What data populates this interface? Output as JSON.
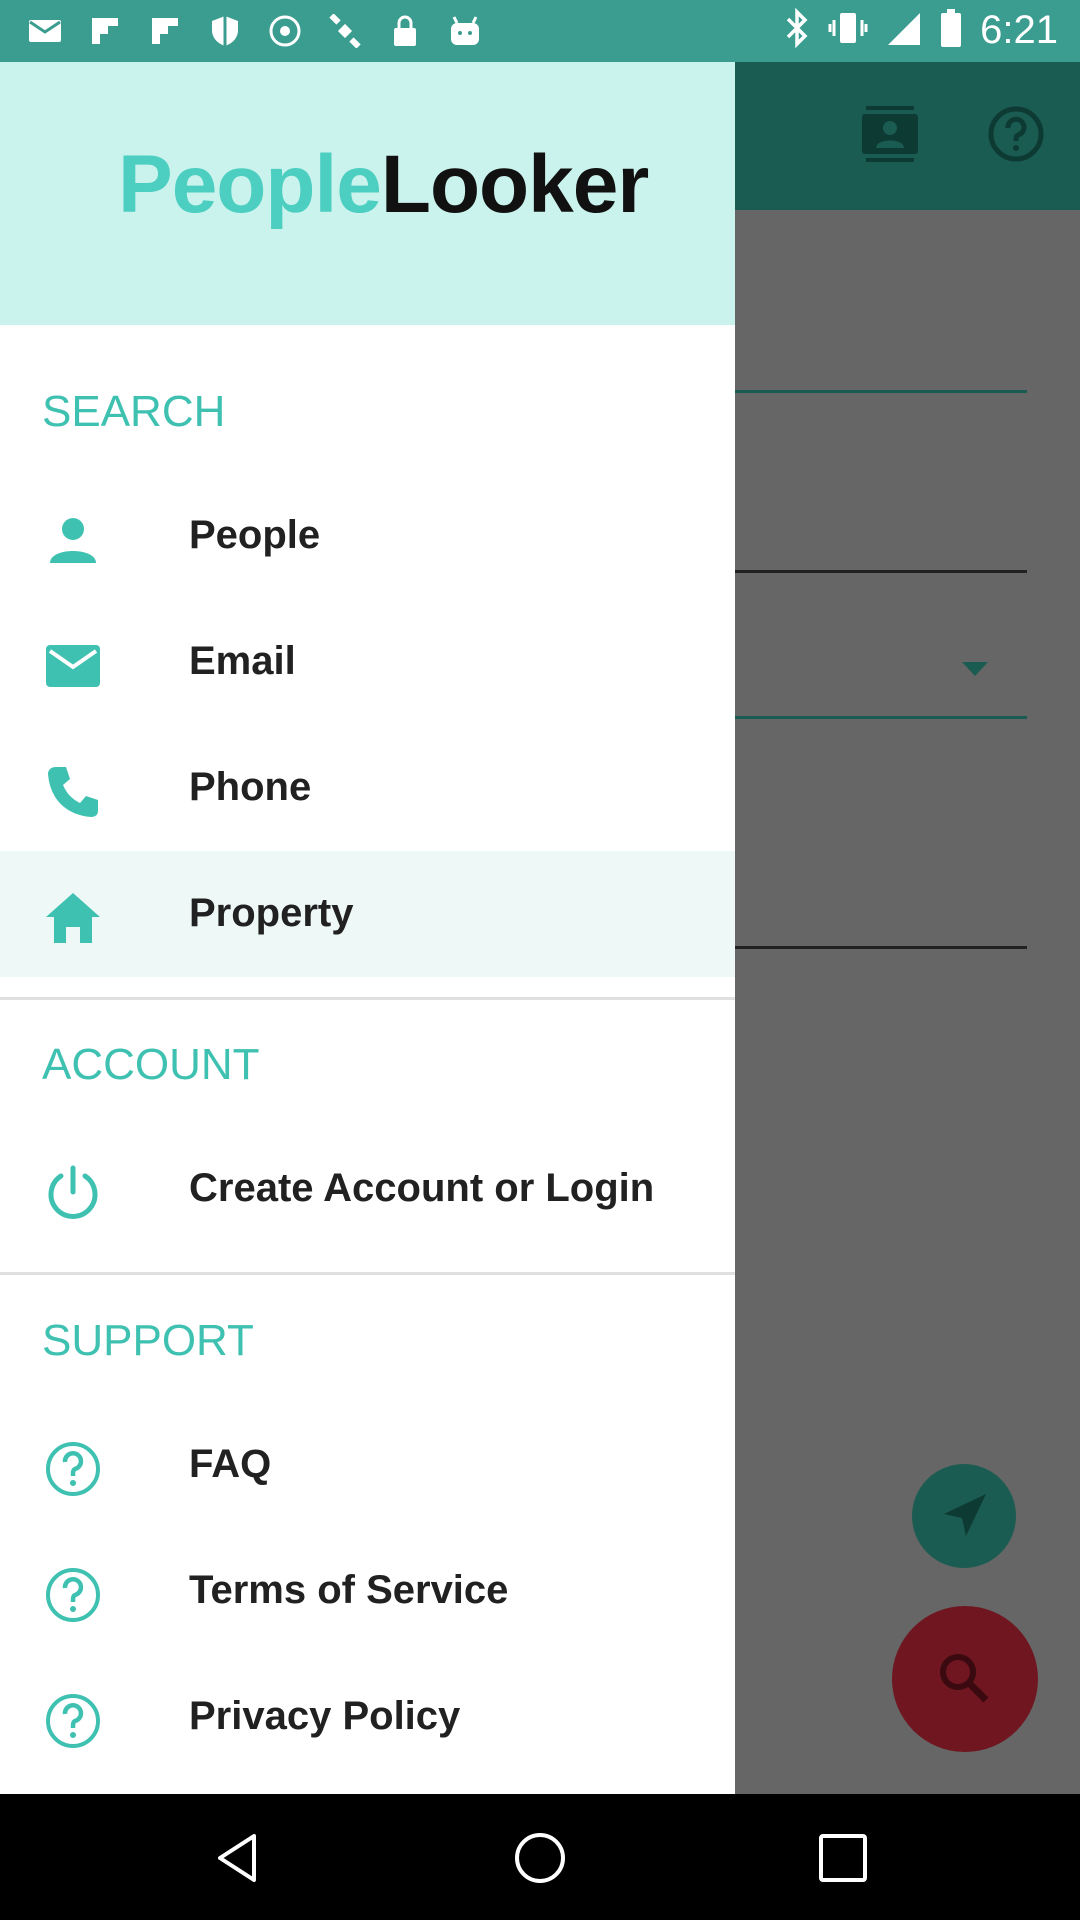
{
  "status_bar": {
    "time": "6:21",
    "icons": [
      "mail-icon",
      "flipboard-icon",
      "flipboard-icon",
      "shield-icon",
      "wireless-icon",
      "satellite-icon",
      "lock-icon",
      "android-icon"
    ],
    "right_icons": [
      "bluetooth-icon",
      "vibrate-icon",
      "signal-icon",
      "battery-icon"
    ]
  },
  "app": {
    "logo_part1": "People",
    "logo_part2": "Looker",
    "colors": {
      "accent": "#3fc1b1",
      "header_bg": "#cbf3ee",
      "app_bar": "#1a5b52",
      "fab_search": "#6f1620"
    }
  },
  "drawer": {
    "sections": [
      {
        "title": "SEARCH",
        "items": [
          {
            "label": "People",
            "icon": "person-icon"
          },
          {
            "label": "Email",
            "icon": "email-icon"
          },
          {
            "label": "Phone",
            "icon": "phone-icon"
          },
          {
            "label": "Property",
            "icon": "home-icon",
            "active": true
          }
        ]
      },
      {
        "title": "ACCOUNT",
        "items": [
          {
            "label": "Create Account or Login",
            "icon": "power-icon"
          }
        ]
      },
      {
        "title": "SUPPORT",
        "items": [
          {
            "label": "FAQ",
            "icon": "help-icon"
          },
          {
            "label": "Terms of Service",
            "icon": "help-icon"
          },
          {
            "label": "Privacy Policy",
            "icon": "help-icon"
          }
        ]
      }
    ]
  }
}
